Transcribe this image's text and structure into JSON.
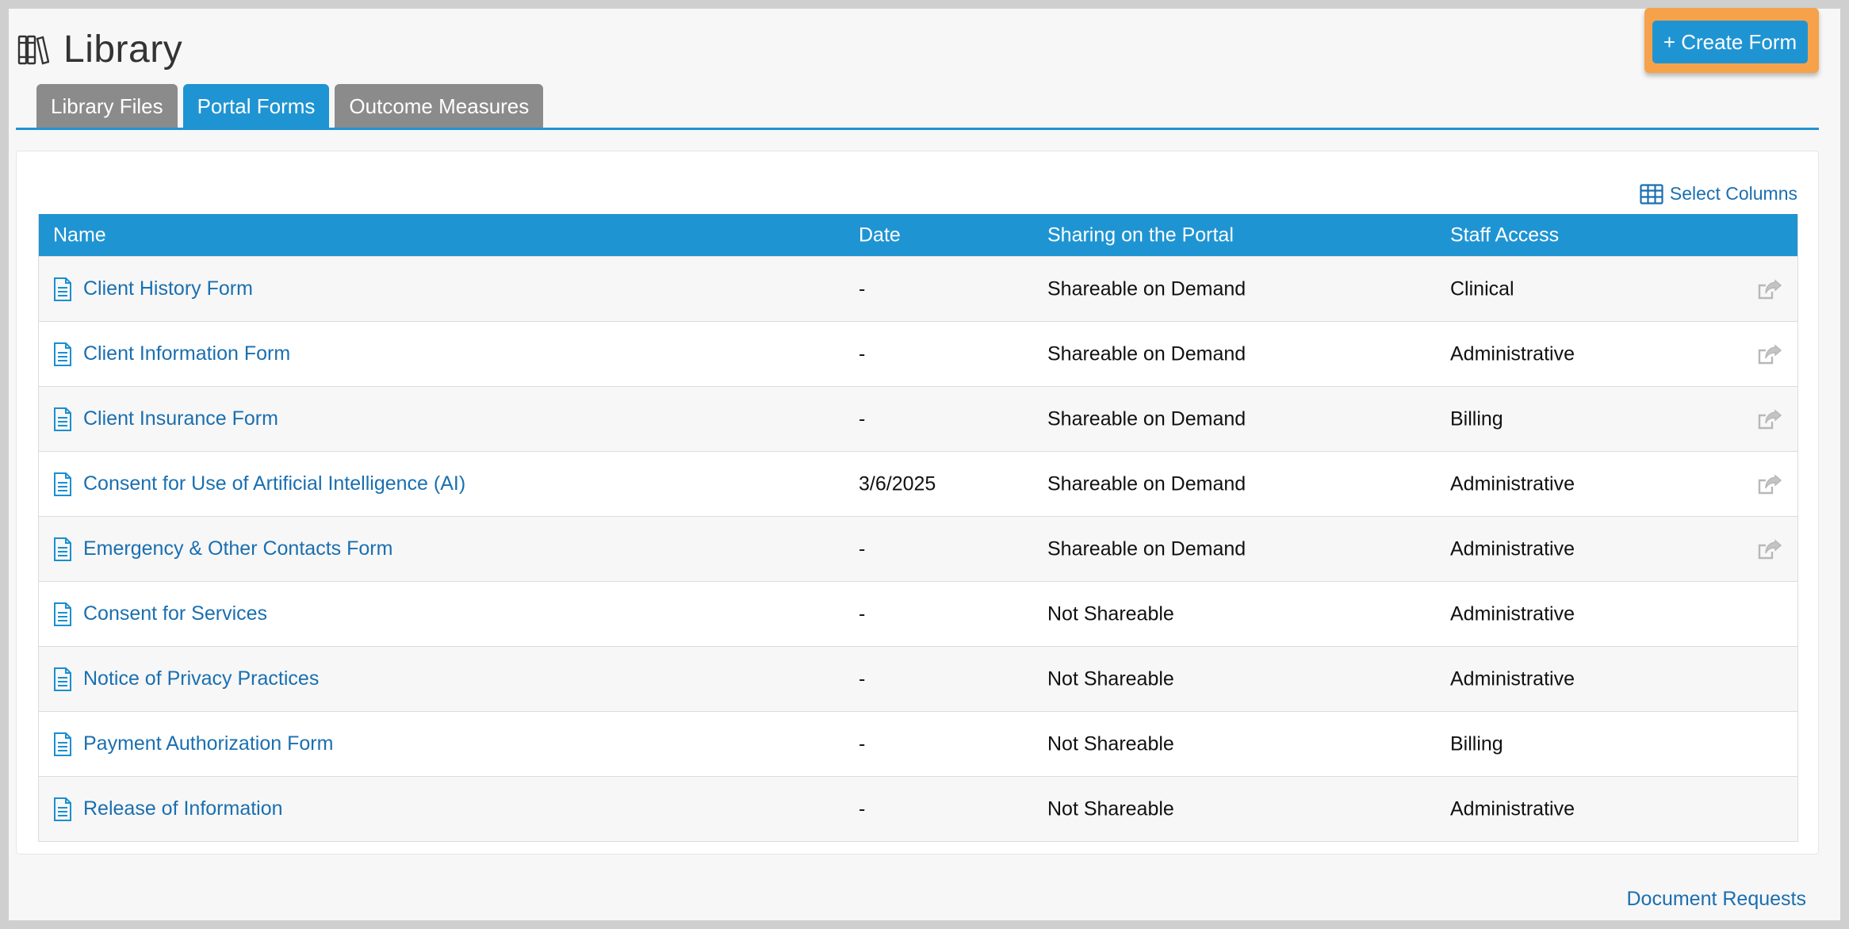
{
  "header": {
    "title": "Library",
    "title_icon": "books-icon",
    "create_button_label": "+ Create Form",
    "highlight_color": "#f6a24a",
    "accent_color": "#1f94d3"
  },
  "tabs": [
    {
      "label": "Library Files",
      "active": false
    },
    {
      "label": "Portal Forms",
      "active": true
    },
    {
      "label": "Outcome Measures",
      "active": false
    }
  ],
  "table": {
    "select_columns_label": "Select Columns",
    "columns": [
      "Name",
      "Date",
      "Sharing on the Portal",
      "Staff Access"
    ],
    "rows": [
      {
        "name": "Client History Form",
        "date": "-",
        "sharing": "Shareable on Demand",
        "staff": "Clinical",
        "share_action": true
      },
      {
        "name": "Client Information Form",
        "date": "-",
        "sharing": "Shareable on Demand",
        "staff": "Administrative",
        "share_action": true
      },
      {
        "name": "Client Insurance Form",
        "date": "-",
        "sharing": "Shareable on Demand",
        "staff": "Billing",
        "share_action": true
      },
      {
        "name": "Consent for Use of Artificial Intelligence (AI)",
        "date": "3/6/2025",
        "sharing": "Shareable on Demand",
        "staff": "Administrative",
        "share_action": true
      },
      {
        "name": "Emergency & Other Contacts Form",
        "date": "-",
        "sharing": "Shareable on Demand",
        "staff": "Administrative",
        "share_action": true
      },
      {
        "name": "Consent for Services",
        "date": "-",
        "sharing": "Not Shareable",
        "staff": "Administrative",
        "share_action": false
      },
      {
        "name": "Notice of Privacy Practices",
        "date": "-",
        "sharing": "Not Shareable",
        "staff": "Administrative",
        "share_action": false
      },
      {
        "name": "Payment Authorization Form",
        "date": "-",
        "sharing": "Not Shareable",
        "staff": "Billing",
        "share_action": false
      },
      {
        "name": "Release of Information",
        "date": "-",
        "sharing": "Not Shareable",
        "staff": "Administrative",
        "share_action": false
      }
    ]
  },
  "footer": {
    "document_requests_label": "Document Requests"
  }
}
